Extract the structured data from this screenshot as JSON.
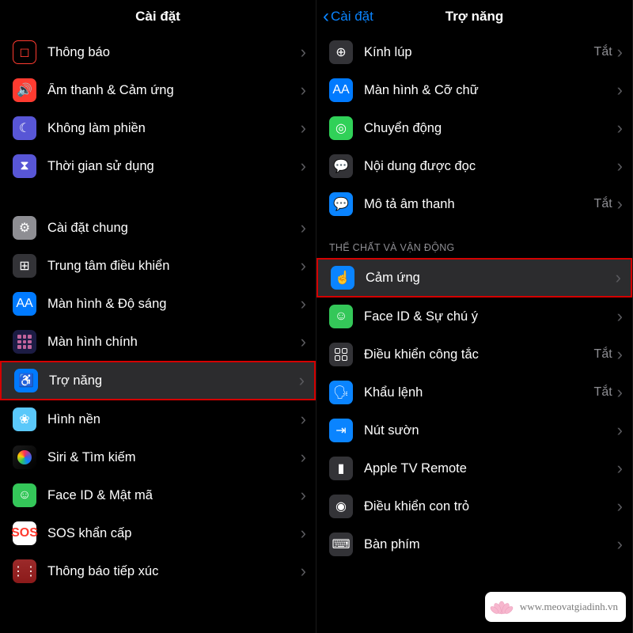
{
  "left": {
    "title": "Cài đặt",
    "rows": [
      {
        "label": "Thông báo",
        "icon": "notification-outline-icon",
        "iconClass": "ic-red-outline",
        "glyph": "◻"
      },
      {
        "label": "Âm thanh & Cảm ứng",
        "icon": "sound-icon",
        "iconClass": "ic-red",
        "glyph": "🔊"
      },
      {
        "label": "Không làm phiền",
        "icon": "moon-icon",
        "iconClass": "ic-purple",
        "glyph": "☾"
      },
      {
        "label": "Thời gian sử dụng",
        "icon": "hourglass-icon",
        "iconClass": "ic-indigo",
        "glyph": "⧗"
      },
      {
        "gap": true
      },
      {
        "label": "Cài đặt chung",
        "icon": "gear-icon",
        "iconClass": "ic-grey",
        "glyph": "⚙"
      },
      {
        "label": "Trung tâm điều khiển",
        "icon": "toggle-icon",
        "iconClass": "ic-darkgrey",
        "glyph": "⊞"
      },
      {
        "label": "Màn hình & Độ sáng",
        "icon": "display-icon",
        "iconClass": "ic-blue",
        "glyph": "AA"
      },
      {
        "label": "Màn hình chính",
        "icon": "grid-icon",
        "iconClass": "ic-navy",
        "glyph": "grid9"
      },
      {
        "label": "Trợ năng",
        "icon": "accessibility-icon",
        "iconClass": "ic-blue",
        "glyph": "♿",
        "highlighted": true
      },
      {
        "label": "Hình nền",
        "icon": "wallpaper-icon",
        "iconClass": "ic-cyan",
        "glyph": "❀"
      },
      {
        "label": "Siri & Tìm kiếm",
        "icon": "siri-icon",
        "iconClass": "ic-gradient-siri",
        "glyph": "siri"
      },
      {
        "label": "Face ID & Mật mã",
        "icon": "faceid-icon",
        "iconClass": "ic-green",
        "glyph": "☺"
      },
      {
        "label": "SOS khẩn cấp",
        "icon": "sos-icon",
        "iconClass": "ic-white",
        "glyph": "SOS"
      },
      {
        "label": "Thông báo tiếp xúc",
        "icon": "exposure-icon",
        "iconClass": "ic-dots",
        "glyph": "⋮⋮"
      }
    ]
  },
  "right": {
    "back": "Cài đặt",
    "title": "Trợ năng",
    "section_header": "THỂ CHẤT VÀ VẬN ĐỘNG",
    "rows_top": [
      {
        "label": "Kính lúp",
        "icon": "magnifier-icon",
        "iconClass": "ic-darkgrey",
        "glyph": "⊕",
        "status": "Tắt"
      },
      {
        "label": "Màn hình & Cỡ chữ",
        "icon": "textsize-icon",
        "iconClass": "ic-blue",
        "glyph": "AA"
      },
      {
        "label": "Chuyển động",
        "icon": "motion-icon",
        "iconClass": "ic-green2",
        "glyph": "◎"
      },
      {
        "label": "Nội dung được đọc",
        "icon": "spoken-icon",
        "iconClass": "ic-darkgrey",
        "glyph": "💬"
      },
      {
        "label": "Mô tả âm thanh",
        "icon": "audiodesc-icon",
        "iconClass": "ic-blue2",
        "glyph": "💬",
        "status": "Tắt"
      }
    ],
    "rows_bottom": [
      {
        "label": "Cảm ứng",
        "icon": "touch-icon",
        "iconClass": "ic-blue2",
        "glyph": "☝",
        "highlighted": true
      },
      {
        "label": "Face ID & Sự chú ý",
        "icon": "faceid-icon",
        "iconClass": "ic-green",
        "glyph": "☺"
      },
      {
        "label": "Điều khiển công tắc",
        "icon": "switch-icon",
        "iconClass": "ic-darkgrey",
        "glyph": "grid4",
        "status": "Tắt"
      },
      {
        "label": "Khẩu lệnh",
        "icon": "voice-icon",
        "iconClass": "ic-blue2",
        "glyph": "🗣",
        "status": "Tắt"
      },
      {
        "label": "Nút sườn",
        "icon": "sidebutton-icon",
        "iconClass": "ic-blue2",
        "glyph": "⇥"
      },
      {
        "label": "Apple TV Remote",
        "icon": "remote-icon",
        "iconClass": "ic-darkgrey",
        "glyph": "▮"
      },
      {
        "label": "Điều khiển con trỏ",
        "icon": "pointer-icon",
        "iconClass": "ic-darkgrey",
        "glyph": "◉"
      },
      {
        "label": "Bàn phím",
        "icon": "keyboard-icon",
        "iconClass": "ic-darkgrey",
        "glyph": "⌨"
      }
    ]
  },
  "watermark": {
    "url": "www.meovatgiadinh.vn"
  }
}
